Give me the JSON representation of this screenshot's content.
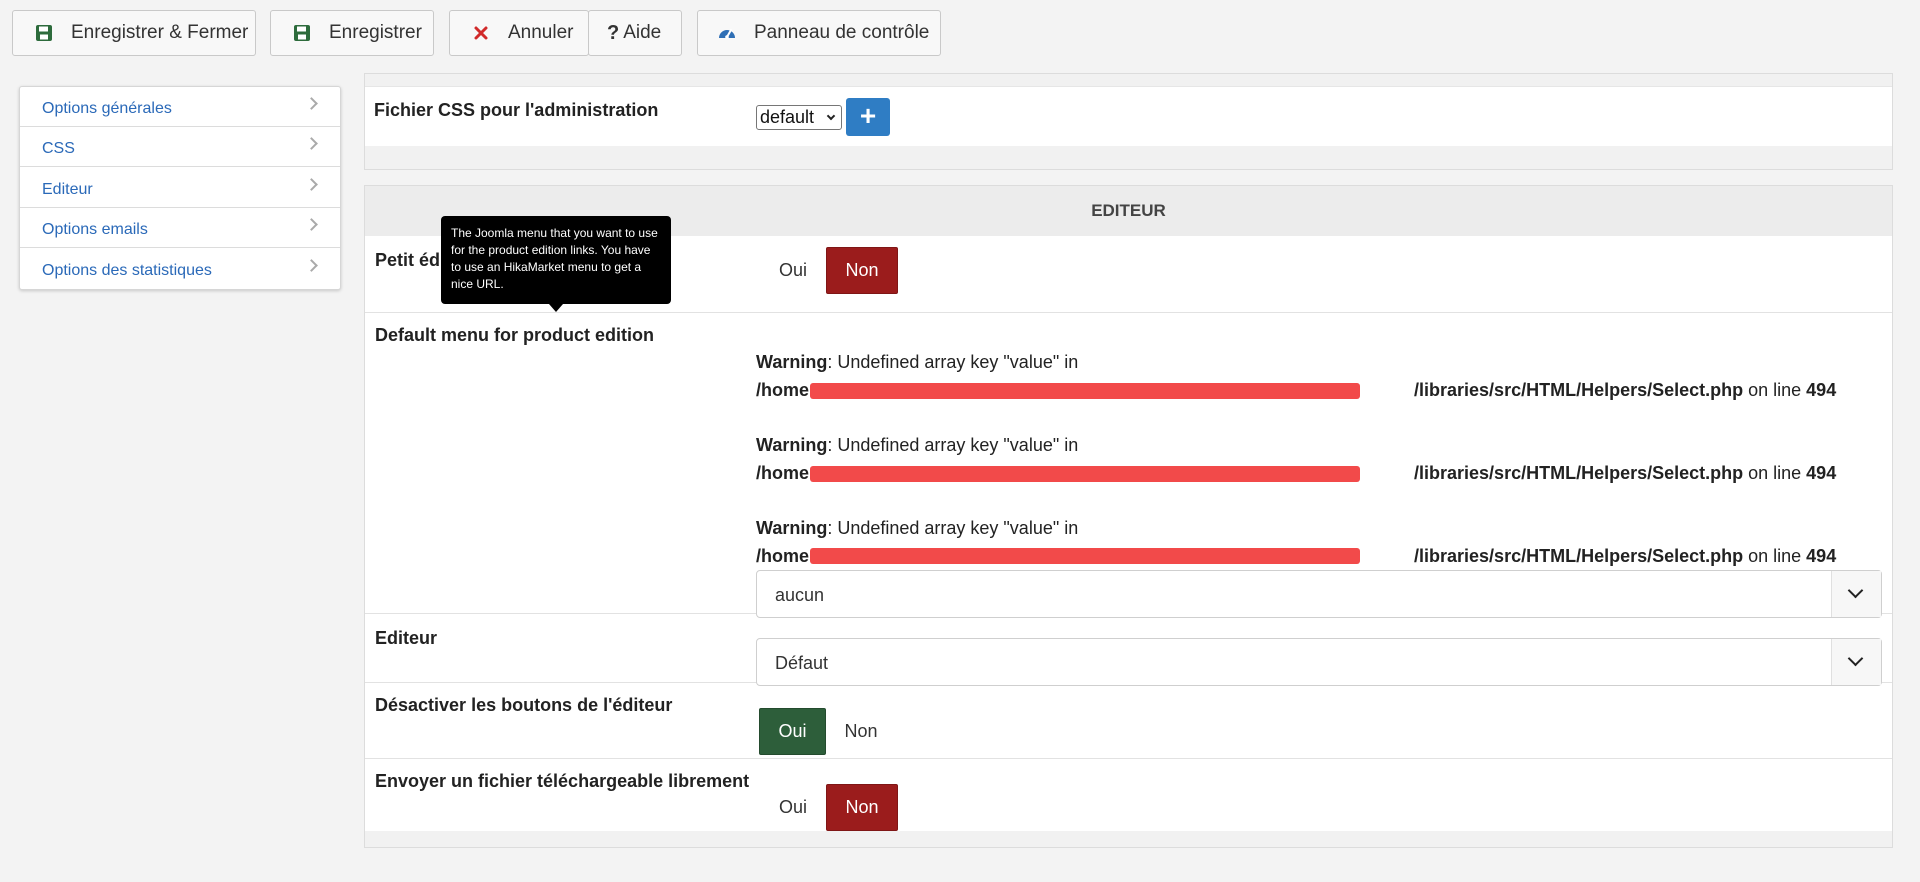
{
  "toolbar": {
    "save_close_label": "Enregistrer & Fermer",
    "save_label": "Enregistrer",
    "cancel_label": "Annuler",
    "help_label": "Aide",
    "control_panel_label": "Panneau de contrôle"
  },
  "sidebar": {
    "items": [
      {
        "label": "Options générales"
      },
      {
        "label": "CSS"
      },
      {
        "label": "Editeur"
      },
      {
        "label": "Options emails"
      },
      {
        "label": "Options des statistiques"
      }
    ]
  },
  "css_section": {
    "label": "Fichier CSS pour l'administration",
    "select_value": "default",
    "add_button": "+"
  },
  "editor_section": {
    "title": "EDITEUR",
    "small_editor": {
      "label": "Petit éditeur",
      "visible_label": "Petit édi",
      "yes": "Oui",
      "no": "Non",
      "selected": "Non"
    },
    "tooltip": "The Joomla menu that you want to use for the product edition links. You have to use an HikaMarket menu to get a nice URL.",
    "default_menu": {
      "label": "Default menu for product edition",
      "warnings": [
        {
          "kind": "Warning",
          "message": ": Undefined array key \"value\" in",
          "path_start": "/home",
          "path_end": "/libraries/src/HTML/Helpers/Select.php",
          "on_line": " on line ",
          "line": "494"
        },
        {
          "kind": "Warning",
          "message": ": Undefined array key \"value\" in",
          "path_start": "/home",
          "path_end": "/libraries/src/HTML/Helpers/Select.php",
          "on_line": " on line ",
          "line": "494"
        },
        {
          "kind": "Warning",
          "message": ": Undefined array key \"value\" in",
          "path_start": "/home",
          "path_end": "/libraries/src/HTML/Helpers/Select.php",
          "on_line": " on line ",
          "line": "494"
        }
      ],
      "select_value": "aucun"
    },
    "editor": {
      "label": "Editeur",
      "select_value": "Défaut"
    },
    "disable_buttons": {
      "label": "Désactiver les boutons de l'éditeur",
      "yes": "Oui",
      "no": "Non",
      "selected": "Oui"
    },
    "free_upload": {
      "label": "Envoyer un fichier téléchargeable librement",
      "yes": "Oui",
      "no": "Non",
      "selected": "Non"
    }
  },
  "colors": {
    "accent_blue": "#2f7dc4",
    "toggle_red": "#9b1c1c",
    "toggle_green": "#2d5e3a",
    "redaction_red": "#f24a4a",
    "link_blue": "#2a69b8"
  },
  "icons": {
    "save_close": "floppy-disk-icon",
    "save": "floppy-disk-icon",
    "cancel": "close-icon",
    "help": "question-mark-icon",
    "control_panel": "dashboard-gauge-icon"
  }
}
